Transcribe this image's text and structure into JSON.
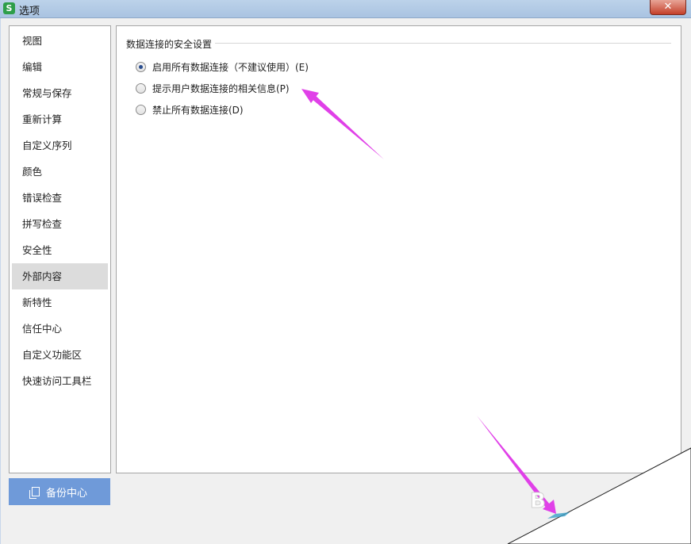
{
  "window": {
    "title": "选项",
    "app_icon_letter": "S",
    "close_symbol": "✕"
  },
  "sidebar": {
    "items": [
      {
        "label": "视图"
      },
      {
        "label": "编辑"
      },
      {
        "label": "常规与保存"
      },
      {
        "label": "重新计算"
      },
      {
        "label": "自定义序列"
      },
      {
        "label": "颜色"
      },
      {
        "label": "错误检查"
      },
      {
        "label": "拼写检查"
      },
      {
        "label": "安全性"
      },
      {
        "label": "外部内容"
      },
      {
        "label": "新特性"
      },
      {
        "label": "信任中心"
      },
      {
        "label": "自定义功能区"
      },
      {
        "label": "快速访问工具栏"
      }
    ],
    "selected": "外部内容"
  },
  "content": {
    "group_title": "数据连接的安全设置",
    "options": [
      {
        "label": "启用所有数据连接（不建议使用）(E)",
        "checked": true
      },
      {
        "label": "提示用户数据连接的相关信息(P)",
        "checked": false
      },
      {
        "label": "禁止所有数据连接(D)",
        "checked": false
      }
    ]
  },
  "footer": {
    "backup_label": "备份中心"
  },
  "colors": {
    "accent": "#6f9ad9",
    "annotation_arrow": "#e040e8",
    "radio_dot": "#2a4d8e"
  }
}
